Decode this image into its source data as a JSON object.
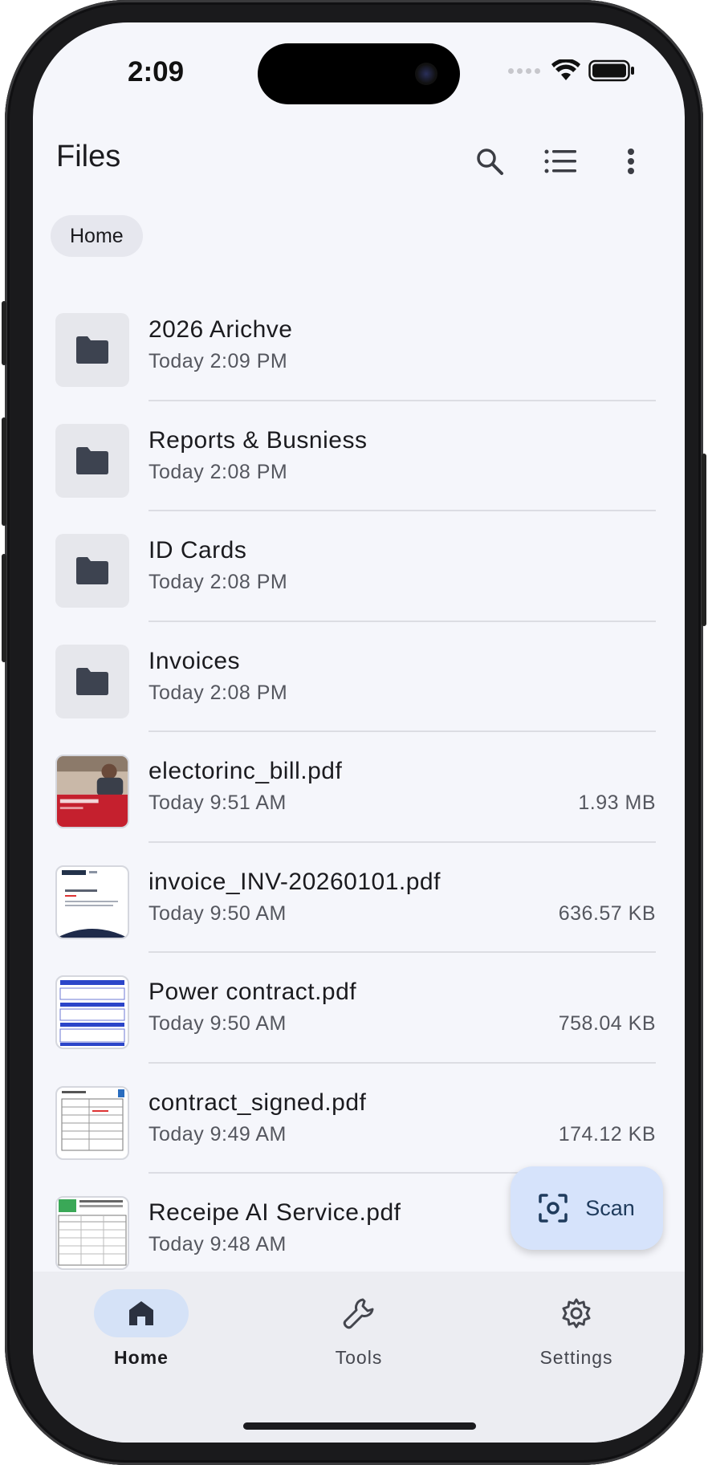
{
  "status_bar": {
    "time": "2:09"
  },
  "app_bar": {
    "title": "Files",
    "icons": [
      "search-icon",
      "list-view-icon",
      "more-vert-icon"
    ]
  },
  "breadcrumb": {
    "label": "Home"
  },
  "items": [
    {
      "type": "folder",
      "name": "2026 Arichve",
      "date": "Today 2:09 PM",
      "size": ""
    },
    {
      "type": "folder",
      "name": "Reports & Busniess",
      "date": "Today 2:08 PM",
      "size": ""
    },
    {
      "type": "folder",
      "name": "ID Cards",
      "date": "Today 2:08 PM",
      "size": ""
    },
    {
      "type": "folder",
      "name": "Invoices",
      "date": "Today 2:08 PM",
      "size": ""
    },
    {
      "type": "pdf",
      "name": "electorinc_bill.pdf",
      "date": "Today 9:51 AM",
      "size": "1.93 MB"
    },
    {
      "type": "pdf",
      "name": "invoice_INV-20260101.pdf",
      "date": "Today 9:50 AM",
      "size": "636.57 KB"
    },
    {
      "type": "pdf",
      "name": "Power contract.pdf",
      "date": "Today 9:50 AM",
      "size": "758.04 KB"
    },
    {
      "type": "pdf",
      "name": "contract_signed.pdf",
      "date": "Today 9:49 AM",
      "size": "174.12 KB"
    },
    {
      "type": "pdf",
      "name": "Receipe AI Service.pdf",
      "date": "Today 9:48 AM",
      "size": ""
    }
  ],
  "fab": {
    "label": "Scan"
  },
  "nav": [
    {
      "label": "Home",
      "icon": "home-icon",
      "active": true
    },
    {
      "label": "Tools",
      "icon": "wrench-icon",
      "active": false
    },
    {
      "label": "Settings",
      "icon": "gear-icon",
      "active": false
    }
  ],
  "colors": {
    "background": "#f5f6fb",
    "accent": "#d5e2f7",
    "fab": "#d6e3fb"
  }
}
